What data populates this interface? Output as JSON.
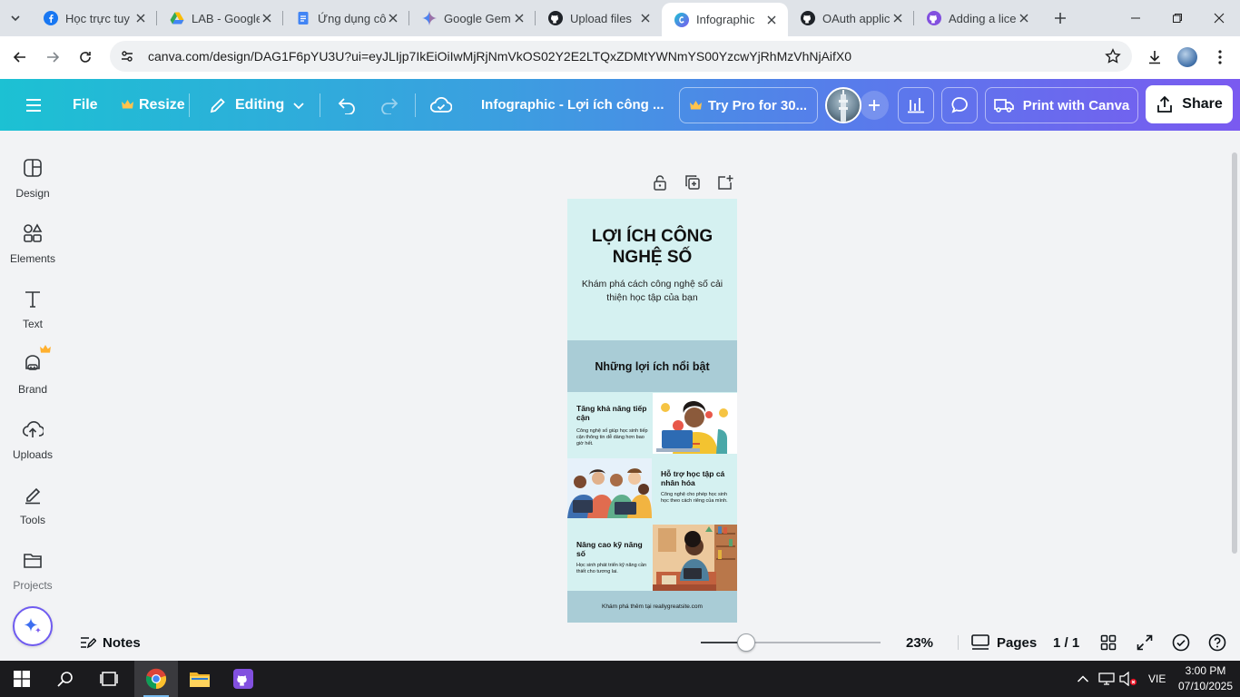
{
  "browser": {
    "tabs": [
      {
        "title": "Học trực tuy",
        "icon": "facebook-icon"
      },
      {
        "title": "LAB - Google",
        "icon": "google-drive-icon"
      },
      {
        "title": "Ứng dụng cô",
        "icon": "google-docs-icon"
      },
      {
        "title": "Google Gem",
        "icon": "gemini-icon"
      },
      {
        "title": "Upload files",
        "icon": "github-icon"
      },
      {
        "title": "Infographic",
        "icon": "canva-icon",
        "active": true
      },
      {
        "title": "OAuth applic",
        "icon": "github-icon"
      },
      {
        "title": "Adding a lice",
        "icon": "github-icon"
      }
    ],
    "url": "canva.com/design/DAG1F6pYU3U?ui=eyJLIjp7IkEiOiIwMjRjNmVkOS02Y2E2LTQxZDMtYWNmYS00YzcwYjRhMzVhNjAifX0"
  },
  "toolbar": {
    "file": "File",
    "resize": "Resize",
    "editing": "Editing",
    "doc_title": "Infographic - Lợi ích công ...",
    "try_pro": "Try Pro for 30...",
    "print": "Print with Canva",
    "share": "Share"
  },
  "sidebar": {
    "items": [
      {
        "label": "Design",
        "icon": "design-icon"
      },
      {
        "label": "Elements",
        "icon": "elements-icon"
      },
      {
        "label": "Text",
        "icon": "text-icon"
      },
      {
        "label": "Brand",
        "icon": "brand-icon"
      },
      {
        "label": "Uploads",
        "icon": "uploads-icon"
      },
      {
        "label": "Tools",
        "icon": "tools-icon"
      },
      {
        "label": "Projects",
        "icon": "projects-icon"
      }
    ]
  },
  "design": {
    "title": "LỢI ÍCH CÔNG NGHỆ SỐ",
    "subtitle": "Khám phá cách công nghệ số cải thiện học tập của bạn",
    "band": "Những lợi ích nổi bật",
    "blocks": [
      {
        "heading": "Tăng khả năng tiếp cận",
        "text": "Công nghệ số giúp học sinh tiếp cận thông tin dễ dàng hơn bao giờ hết."
      },
      {
        "heading": "Hỗ trợ học tập cá nhân hóa",
        "text": "Công nghệ cho phép học sinh học theo cách riêng của mình."
      },
      {
        "heading": "Nâng cao kỹ năng số",
        "text": "Học sinh phát triển kỹ năng cần thiết cho tương lai."
      }
    ],
    "footer": "Khám phá thêm tại reallygreatsite.com"
  },
  "bottom": {
    "notes": "Notes",
    "zoom_value": 0.25,
    "zoom_label": "23%",
    "pages": "Pages",
    "page_count": "1 / 1"
  },
  "taskbar": {
    "language": "VIE",
    "time": "3:00 PM",
    "date": "07/10/2025"
  },
  "colors": {
    "toolbar_start": "#1cc1d3",
    "toolbar_end": "#7a5af0",
    "page_bg": "#d5f1f1",
    "band_bg": "#a9ccd6",
    "accent": "#6f5bf0"
  }
}
